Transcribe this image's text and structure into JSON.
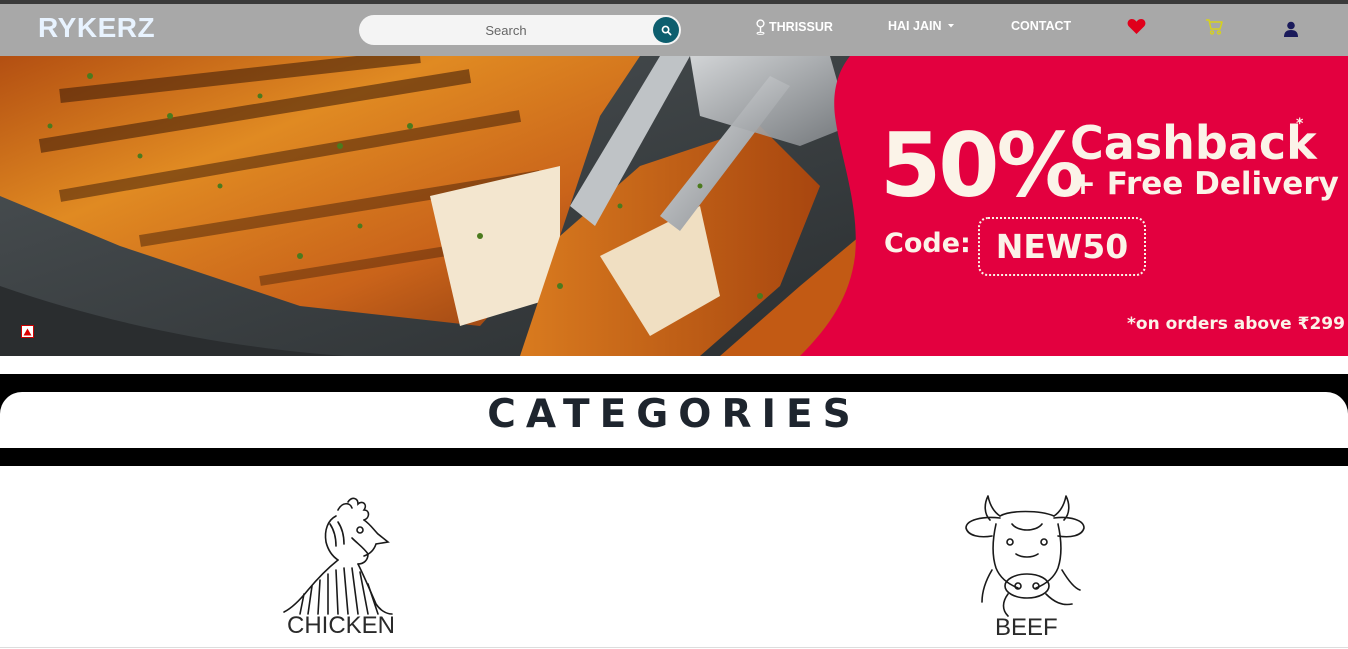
{
  "brand": {
    "logo": "RYKERZ"
  },
  "search": {
    "placeholder": "Search"
  },
  "nav": {
    "location": "THRISSUR",
    "user_menu": "HAI JAIN",
    "contact": "CONTACT",
    "icons": [
      "location-pin-icon",
      "chevron-down-icon",
      "heart-icon",
      "cart-icon",
      "user-icon"
    ]
  },
  "banner": {
    "percent": "50%",
    "cashback": "Cashback",
    "asterisk": "*",
    "free_delivery": "+ Free Delivery",
    "code_label": "Code:",
    "code": "NEW50",
    "terms": "*on orders above ₹299",
    "colors": {
      "promo_bg": "#e3003f",
      "promo_text": "#fbf3e8"
    }
  },
  "categories": {
    "title": "CATEGORIES",
    "items": [
      {
        "label": "CHICKEN",
        "icon": "chicken-icon"
      },
      {
        "label": "BEEF",
        "icon": "cow-icon"
      }
    ]
  },
  "colors": {
    "navbar": "#a8a8a8",
    "search_button": "#0d5e6e",
    "heart": "#e0001b",
    "cart": "#d8d21a",
    "user": "#1a1a5a"
  }
}
